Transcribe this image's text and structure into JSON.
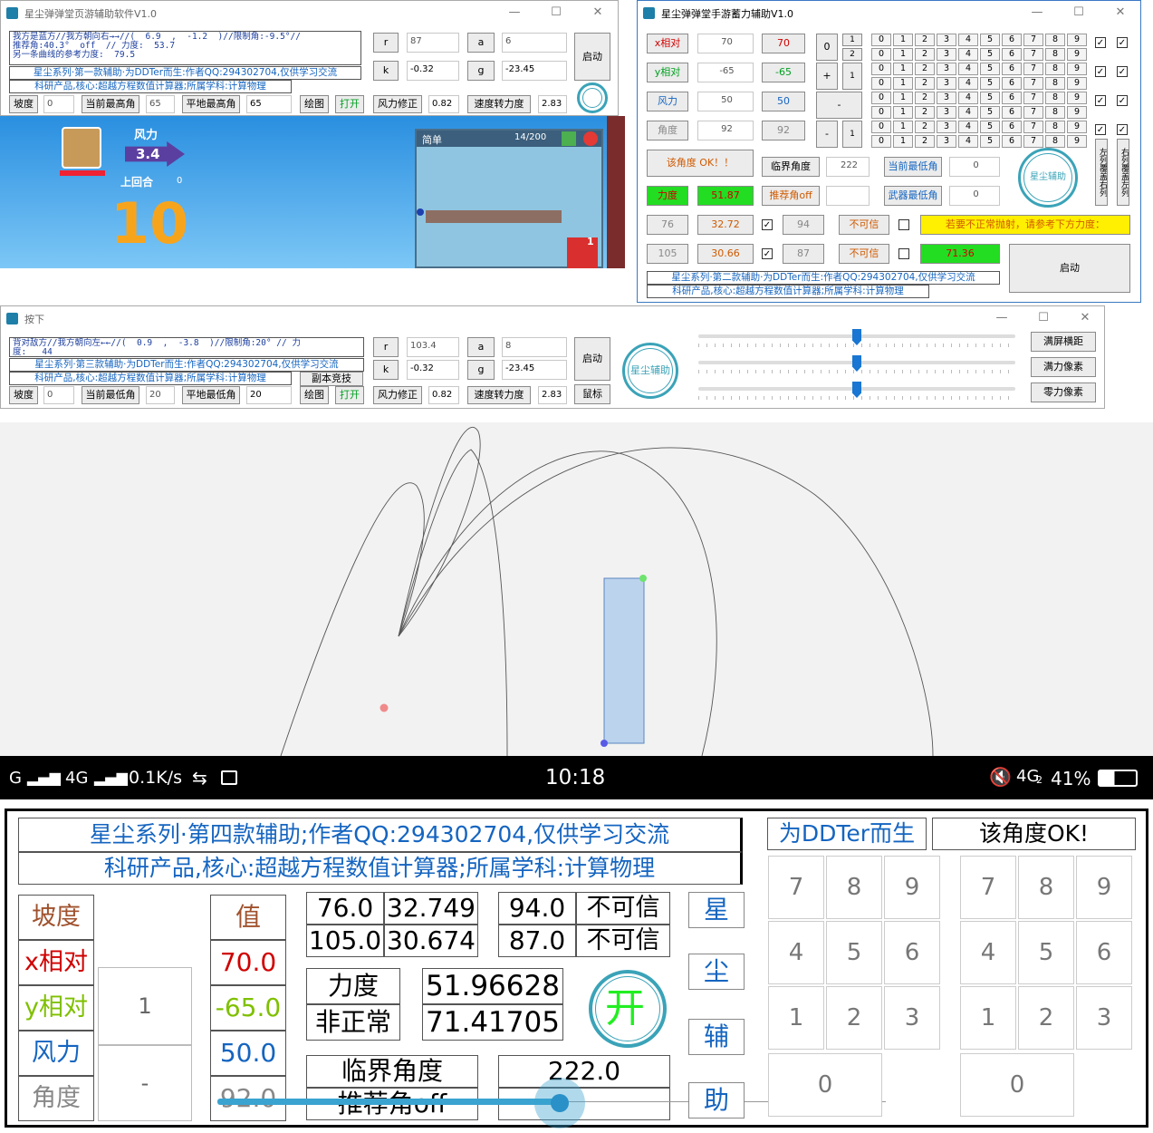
{
  "win1": {
    "title": "星尘弹弹堂页游辅助软件V1.0",
    "info_lines": [
      "我方是蓝方//我方朝向右→→//(  6.9  ,  -1.2  )//限制角:-9.5°//",
      "推荐角:40.3°  off  // 力度:  53.7",
      "另一条曲线的参考力度:  79.5"
    ],
    "banner1": "星尘系列·第一款辅助·为DDTer而生:作者QQ:294302704,仅供学习交流",
    "banner2": "科研产品,核心:超越方程数值计算器;所属学科:计算物理",
    "r_label": "r",
    "r_value": "87",
    "a_label": "a",
    "a_value": "6",
    "k_label": "k",
    "k_value": "-0.32",
    "g_label": "g",
    "g_value": "-23.45",
    "start": "启动",
    "bottom": {
      "slope": "坡度",
      "slope_val": "0",
      "cur_max": "当前最高角",
      "cur_max_val": "65",
      "flat_max": "平地最高角",
      "flat_max_val": "65",
      "draw": "绘图",
      "open": "打开",
      "wind_fix": "风力修正",
      "wind_fix_val": "0.82",
      "speed2force": "速度转力度",
      "speed2force_val": "2.83"
    },
    "logo": "星尘辅助"
  },
  "game": {
    "wind_label": "风力",
    "wind_value": "3.4",
    "last_round": "上回合",
    "last_round_val": "0",
    "countdown": "10",
    "mode": "简单",
    "count": "14/200",
    "badge": "1"
  },
  "win2": {
    "title": "星尘弹弹堂手游蓄力辅助V1.0",
    "rows": [
      {
        "label": "x相对",
        "val1": "70",
        "val2": "70",
        "color": "#d00000"
      },
      {
        "label": "y相对",
        "val1": "-65",
        "val2": "-65",
        "color": "#00a020"
      },
      {
        "label": "风力",
        "val1": "50",
        "val2": "50",
        "color": "#1565c0"
      },
      {
        "label": "角度",
        "val1": "92",
        "val2": "92",
        "color": "#888888"
      }
    ],
    "pad": {
      "zero": "0",
      "one_a": "1",
      "two": "2",
      "plus": "+",
      "one_b": "1",
      "minus": "-",
      "minus2": "-",
      "one_c": "1"
    },
    "digits": [
      "0",
      "1",
      "2",
      "3",
      "4",
      "5",
      "6",
      "7",
      "8",
      "9"
    ],
    "col_left": "左列覆盖右列",
    "col_right": "右列覆盖左列",
    "ok_msg": "该角度 OK！！",
    "critical": "临界角度",
    "critical_val": "222",
    "cur_min": "当前最低角",
    "cur_min_val": "0",
    "force": "力度",
    "force_val": "51.87",
    "recommend": "推荐角off",
    "weapon_min": "武器最低角",
    "weapon_min_val": "0",
    "r1": {
      "a": "76",
      "b": "32.72",
      "c": "94",
      "d": "不可信"
    },
    "r2": {
      "a": "105",
      "b": "30.66",
      "c": "87",
      "d": "不可信"
    },
    "warn": "若要不正常抛射，请参考下方力度：",
    "alt_force": "71.36",
    "start": "启动",
    "banner1": "星尘系列·第二款辅助·为DDTer而生:作者QQ:294302704,仅供学习交流",
    "banner2": "科研产品,核心:超越方程数值计算器;所属学科:计算物理",
    "logo": "星尘辅助"
  },
  "win3": {
    "title": "按下",
    "info_lines": [
      "背对敌方//我方朝向左←←//(  0.9  ,  -3.8  )//限制角:20° // 力",
      "度:   44"
    ],
    "banner1": "星尘系列·第三款辅助·为DDTer而生:作者QQ:294302704,仅供学习交流",
    "banner2": "科研产品,核心:超越方程数值计算器;所属学科:计算物理",
    "copy_compete": "副本竞技",
    "r_label": "r",
    "r_value": "103.4",
    "a_label": "a",
    "a_value": "8",
    "k_label": "k",
    "k_value": "-0.32",
    "g_label": "g",
    "g_value": "-23.45",
    "start": "启动",
    "mouse": "鼠标",
    "bottom": {
      "slope": "坡度",
      "slope_val": "0",
      "cur_min": "当前最低角",
      "cur_min_val": "20",
      "flat_min": "平地最低角",
      "flat_min_val": "20",
      "draw": "绘图",
      "open": "打开",
      "wind_fix": "风力修正",
      "wind_fix_val": "0.82",
      "speed2force": "速度转力度",
      "speed2force_val": "2.83"
    },
    "full_screen": "满屏横距",
    "full_force": "满力像素",
    "zero_force": "零力像素",
    "logo": "星尘辅助"
  },
  "status": {
    "signal": "G",
    "net": "4G",
    "speed": "0.1K/s",
    "time": "10:18",
    "net2": "4G",
    "sim": "2",
    "battery": "41%"
  },
  "phone": {
    "banner1": "星尘系列·第四款辅助;作者QQ:294302704,仅供学习交流",
    "banner2": "科研产品,核心:超越方程数值计算器;所属学科:计算物理",
    "ddter": "为DDTer而生",
    "ok": "该角度OK!",
    "slope": "坡度",
    "x": "x相对",
    "y": "y相对",
    "wind": "风力",
    "angle": "角度",
    "value": "值",
    "xv": "70.0",
    "yv": "-65.0",
    "wv": "50.0",
    "av": "92.0",
    "step": "1",
    "minus": "-",
    "t1": [
      "76.0",
      "32.749"
    ],
    "t2": [
      "105.0",
      "30.674"
    ],
    "t3": [
      "94.0",
      "不可信"
    ],
    "t4": [
      "87.0",
      "不可信"
    ],
    "force": "力度",
    "abnormal": "非正常",
    "fv": "51.96628",
    "av2": "71.41705",
    "critical": "临界角度",
    "recommend": "推荐角off",
    "cv": "222.0",
    "open": "开",
    "logo": "星尘辅助",
    "side": [
      "星",
      "尘",
      "辅",
      "助"
    ],
    "keys": [
      "7",
      "8",
      "9",
      "4",
      "5",
      "6",
      "1",
      "2",
      "3"
    ],
    "zero": "0"
  }
}
